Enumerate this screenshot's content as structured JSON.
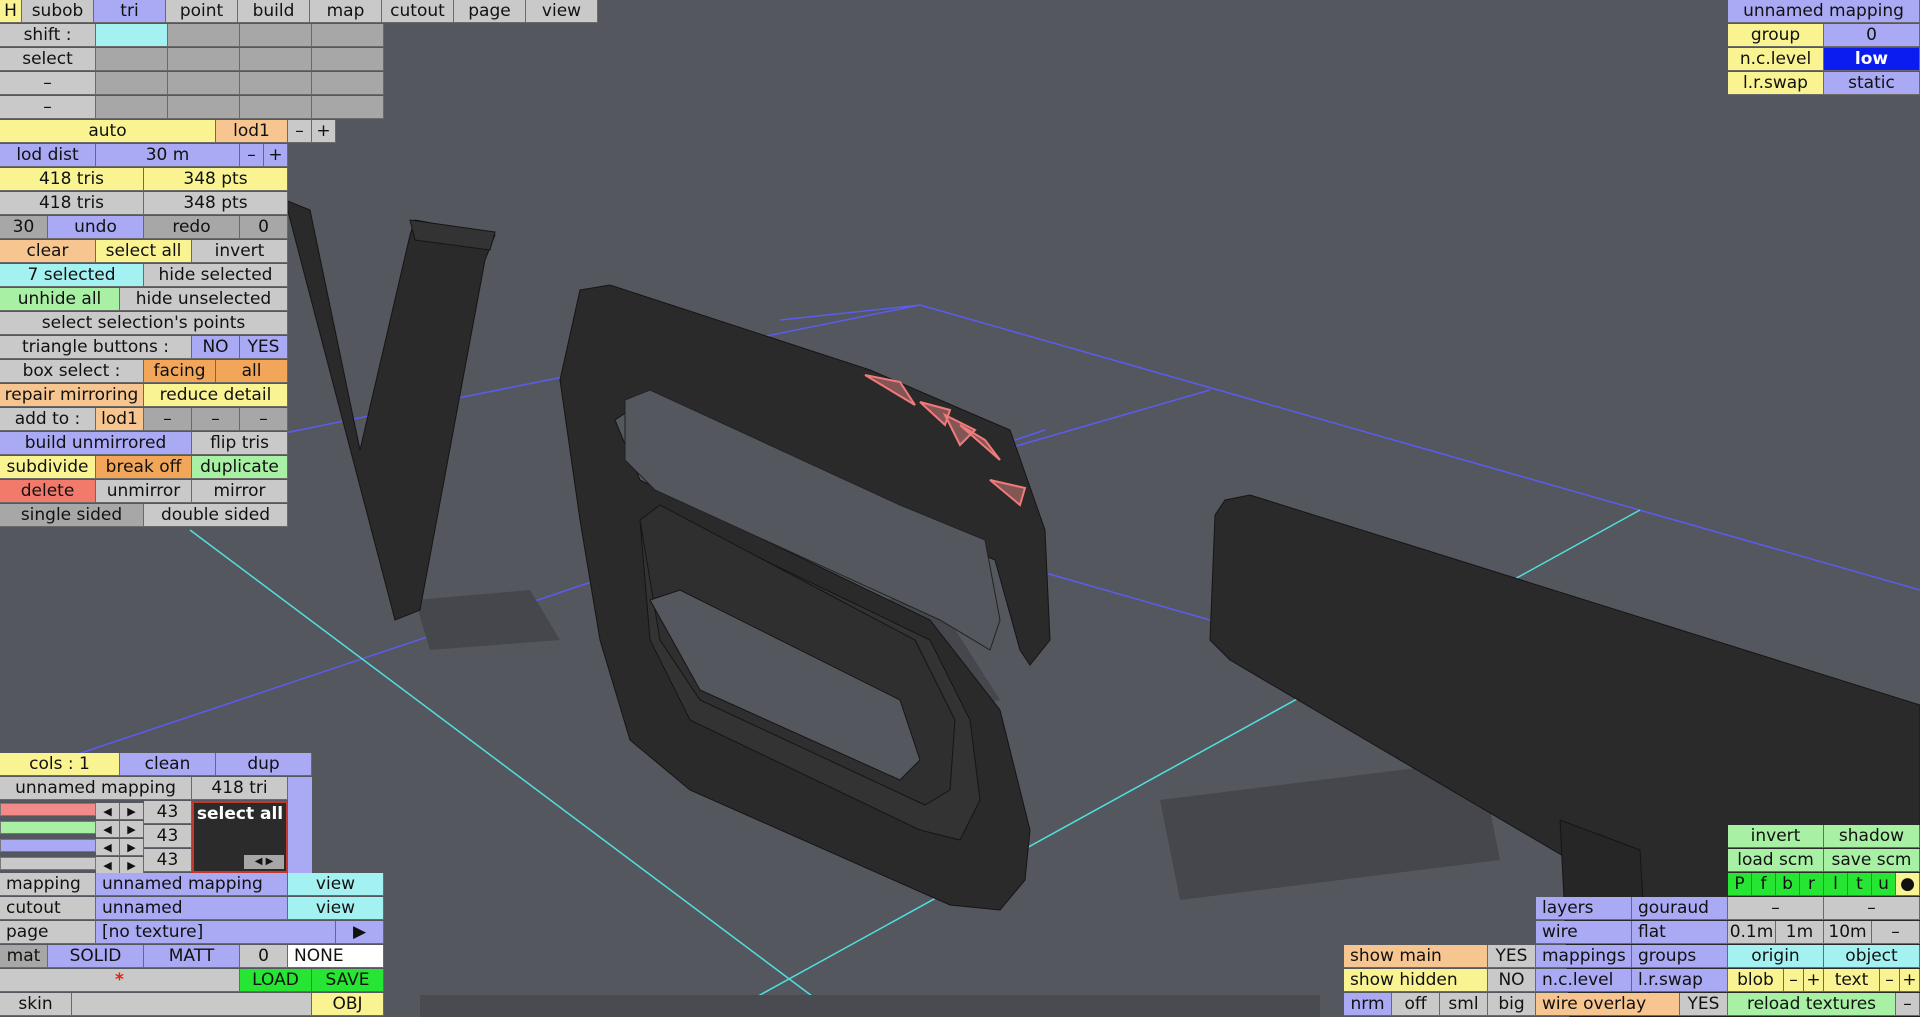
{
  "colors": {
    "background": "#55575e",
    "wire_grid": "#5a5cf0",
    "wire_cyan": "#4fe0e0",
    "mesh": "#2b2b2b",
    "selected_tris": "#f27a7a"
  },
  "top_menu": {
    "h": "H",
    "items": [
      "subob",
      "tri",
      "point",
      "build",
      "map",
      "cutout",
      "page",
      "view"
    ],
    "active": "tri"
  },
  "tri_panel": {
    "shift": "shift :",
    "select": "select",
    "dash1": "–",
    "dash2": "–",
    "auto": "auto",
    "lod": "lod1",
    "minus": "–",
    "plus": "+",
    "lod_dist_label": "lod dist",
    "lod_dist_value": "30 m",
    "tris1": "418 tris",
    "pts1": "348 pts",
    "tris2": "418 tris",
    "pts2": "348 pts",
    "undo_count": "30",
    "undo": "undo",
    "redo": "redo",
    "redo_count": "0",
    "clear": "clear",
    "select_all": "select all",
    "invert": "invert",
    "selected": "7 selected",
    "hide_selected": "hide selected",
    "unhide_all": "unhide all",
    "hide_unselected": "hide unselected",
    "select_points": "select selection's points",
    "triangle_buttons": "triangle buttons :",
    "no": "NO",
    "yes": "YES",
    "box_select": "box select :",
    "facing": "facing",
    "all": "all",
    "repair_mirroring": "repair mirroring",
    "reduce_detail": "reduce detail",
    "add_to": "add to :",
    "add_lod": "lod1",
    "d1": "–",
    "d2": "–",
    "d3": "–",
    "build_unmirrored": "build unmirrored",
    "flip_tris": "flip tris",
    "subdivide": "subdivide",
    "break_off": "break off",
    "duplicate": "duplicate",
    "delete": "delete",
    "unmirror": "unmirror",
    "mirror": "mirror",
    "single_sided": "single sided",
    "double_sided": "double sided"
  },
  "mapping_panel": {
    "title": "unnamed mapping",
    "group": "group",
    "group_value": "0",
    "nc_level": "n.c.level",
    "nc_value": "low",
    "lr_swap": "l.r.swap",
    "lr_value": "static"
  },
  "colour_panel": {
    "cols": "cols : 1",
    "clean": "clean",
    "dup": "dup",
    "mapping_name": "unnamed mapping",
    "tri_count": "418 tri",
    "channels": [
      "43",
      "43",
      "43"
    ],
    "select_all": "select all",
    "mapping_label": "mapping",
    "mapping_value": "unnamed mapping",
    "view1": "view",
    "cutout_label": "cutout",
    "cutout_value": "unnamed",
    "view2": "view",
    "page_label": "page",
    "page_value": "[no texture]",
    "page_arrow": "▶",
    "mat": "mat",
    "solid": "SOLID",
    "matt": "MATT",
    "mat_num": "0",
    "none": "NONE",
    "star": "*",
    "load": "LOAD",
    "save": "SAVE",
    "skin": "skin",
    "obj": "OBJ"
  },
  "view_panel": {
    "show_main": "show main",
    "show_main_val": "YES",
    "show_hidden": "show hidden",
    "show_hidden_val": "NO",
    "nrm": "nrm",
    "off": "off",
    "sml": "sml",
    "big": "big",
    "layers": "layers",
    "gouraud": "gouraud",
    "wire": "wire",
    "flat": "flat",
    "mappings": "mappings",
    "groups": "groups",
    "nc_level": "n.c.level",
    "lr_swap": "l.r.swap",
    "wire_overlay": "wire overlay",
    "wire_overlay_val": "YES",
    "invert": "invert",
    "shadow": "shadow",
    "load_scm": "load scm",
    "save_scm": "save scm",
    "flags": [
      "P",
      "f",
      "b",
      "r",
      "l",
      "t",
      "u",
      "●"
    ],
    "dash_a": "–",
    "dash_b": "–",
    "s01": "0.1m",
    "s1": "1m",
    "s10": "10m",
    "sminus": "–",
    "origin": "origin",
    "object": "object",
    "blob": "blob",
    "blob_minus": "–",
    "blob_plus": "+",
    "text": "text",
    "text_minus": "–",
    "text_plus": "+",
    "reload_textures": "reload textures",
    "reload_minus": "–"
  }
}
